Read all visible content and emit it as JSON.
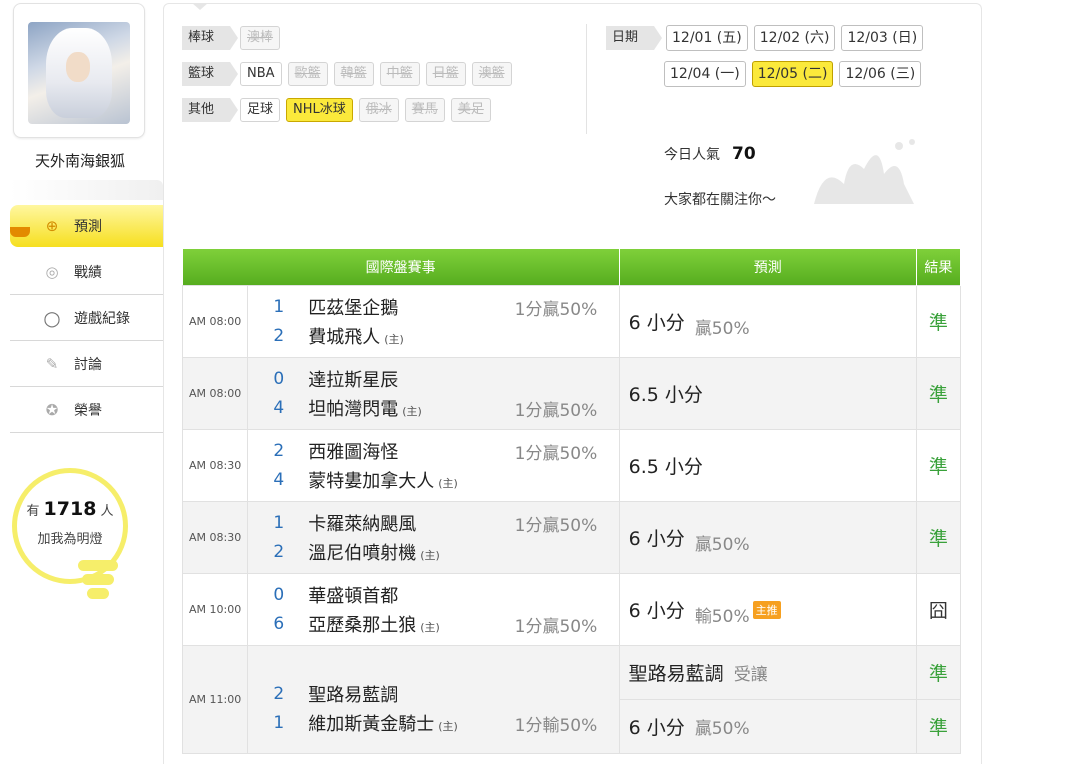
{
  "profile": {
    "name": "天外南海銀狐"
  },
  "nav": [
    {
      "label": "預測",
      "icon": "crosshair-icon"
    },
    {
      "label": "戰績",
      "icon": "chart-icon"
    },
    {
      "label": "遊戲紀錄",
      "icon": "ring-icon"
    },
    {
      "label": "討論",
      "icon": "chat-icon"
    },
    {
      "label": "榮譽",
      "icon": "medal-icon"
    }
  ],
  "lamp": {
    "prefix": "有",
    "count": "1718",
    "suffix": "人",
    "line2": "加我為明燈"
  },
  "categories": [
    {
      "label": "棒球",
      "tags": [
        {
          "text": "澳棒",
          "state": "off"
        }
      ]
    },
    {
      "label": "籃球",
      "tags": [
        {
          "text": "NBA",
          "state": "normal"
        },
        {
          "text": "歐籃",
          "state": "off"
        },
        {
          "text": "韓籃",
          "state": "off"
        },
        {
          "text": "中籃",
          "state": "off"
        },
        {
          "text": "日籃",
          "state": "off"
        },
        {
          "text": "澳籃",
          "state": "off"
        }
      ]
    },
    {
      "label": "其他",
      "tags": [
        {
          "text": "足球",
          "state": "normal"
        },
        {
          "text": "NHL冰球",
          "state": "on"
        },
        {
          "text": "俄冰",
          "state": "off"
        },
        {
          "text": "賽馬",
          "state": "off"
        },
        {
          "text": "美足",
          "state": "off"
        }
      ]
    }
  ],
  "dates": {
    "label": "日期",
    "row1": [
      {
        "text": "12/01 (五)",
        "on": false
      },
      {
        "text": "12/02 (六)",
        "on": false
      },
      {
        "text": "12/03 (日)",
        "on": false
      }
    ],
    "row2": [
      {
        "text": "12/04 (一)",
        "on": false
      },
      {
        "text": "12/05 (二)",
        "on": true
      },
      {
        "text": "12/06 (三)",
        "on": false
      }
    ]
  },
  "popularity": {
    "label": "今日人氣",
    "value": "70",
    "sub": "大家都在關注你～"
  },
  "table": {
    "headers": {
      "event": "國際盤賽事",
      "pred": "預測",
      "result": "結果"
    },
    "games": [
      {
        "time": "AM 08:00",
        "t1": {
          "sc": "1",
          "nm": "匹茲堡企鵝",
          "home": "",
          "odd": "1分贏50%"
        },
        "t2": {
          "sc": "2",
          "nm": "費城飛人",
          "home": "(主)",
          "odd": ""
        },
        "preds": [
          {
            "main": "6 小分",
            "sub": "贏50%",
            "badge": "",
            "res": "準"
          }
        ]
      },
      {
        "time": "AM 08:00",
        "t1": {
          "sc": "0",
          "nm": "達拉斯星辰",
          "home": "",
          "odd": ""
        },
        "t2": {
          "sc": "4",
          "nm": "坦帕灣閃電",
          "home": "(主)",
          "odd": "1分贏50%"
        },
        "preds": [
          {
            "main": "6.5 小分",
            "sub": "",
            "badge": "",
            "res": "準"
          }
        ]
      },
      {
        "time": "AM 08:30",
        "t1": {
          "sc": "2",
          "nm": "西雅圖海怪",
          "home": "",
          "odd": "1分贏50%"
        },
        "t2": {
          "sc": "4",
          "nm": "蒙特婁加拿大人",
          "home": "(主)",
          "odd": ""
        },
        "preds": [
          {
            "main": "6.5 小分",
            "sub": "",
            "badge": "",
            "res": "準"
          }
        ]
      },
      {
        "time": "AM 08:30",
        "t1": {
          "sc": "1",
          "nm": "卡羅萊納颶風",
          "home": "",
          "odd": "1分贏50%"
        },
        "t2": {
          "sc": "2",
          "nm": "溫尼伯噴射機",
          "home": "(主)",
          "odd": ""
        },
        "preds": [
          {
            "main": "6 小分",
            "sub": "贏50%",
            "badge": "",
            "res": "準"
          }
        ]
      },
      {
        "time": "AM 10:00",
        "t1": {
          "sc": "0",
          "nm": "華盛頓首都",
          "home": "",
          "odd": ""
        },
        "t2": {
          "sc": "6",
          "nm": "亞歷桑那土狼",
          "home": "(主)",
          "odd": "1分贏50%"
        },
        "preds": [
          {
            "main": "6 小分",
            "sub": "輸50%",
            "badge": "主推",
            "res": "囧"
          }
        ]
      },
      {
        "time": "AM 11:00",
        "t1": {
          "sc": "2",
          "nm": "聖路易藍調",
          "home": "",
          "odd": ""
        },
        "t2": {
          "sc": "1",
          "nm": "維加斯黃金騎士",
          "home": "(主)",
          "odd": "1分輸50%"
        },
        "preds": [
          {
            "main": "聖路易藍調",
            "sub": "受讓",
            "badge": "",
            "res": "準"
          },
          {
            "main": "6 小分",
            "sub": "贏50%",
            "badge": "",
            "res": "準"
          }
        ]
      }
    ]
  }
}
